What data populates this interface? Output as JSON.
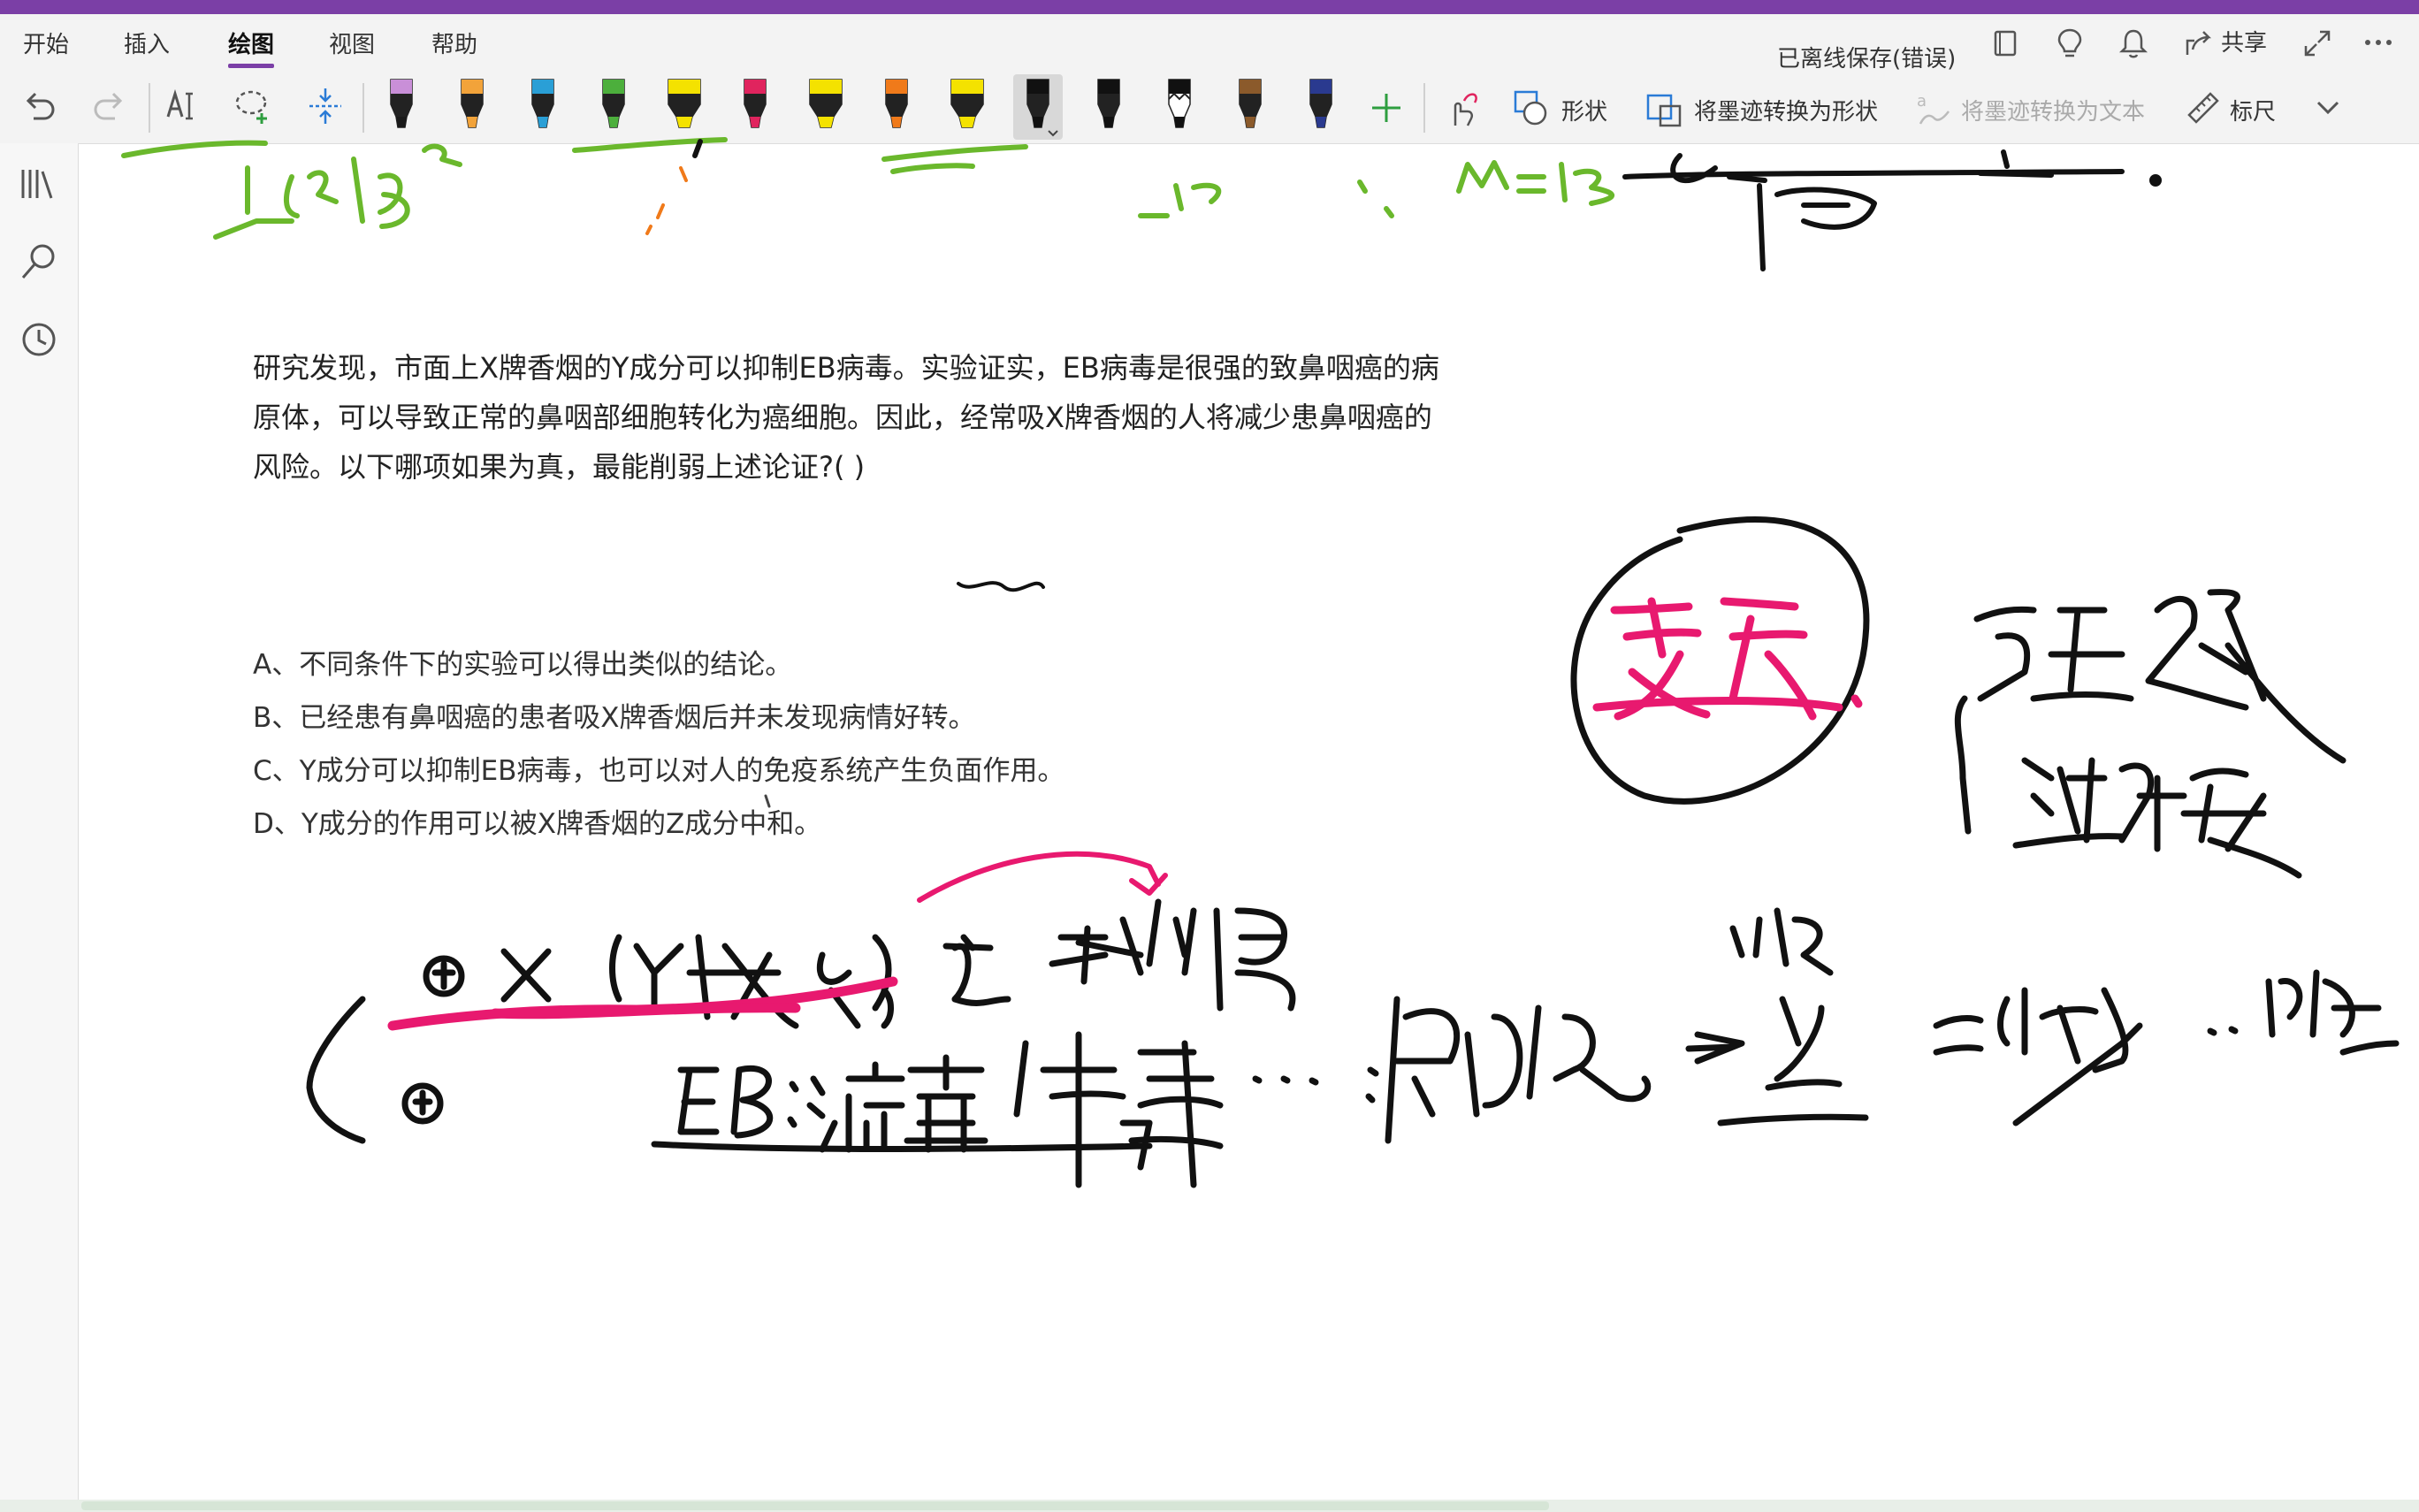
{
  "ribbon": {
    "tabs": [
      {
        "label": "开始",
        "active": false
      },
      {
        "label": "插入",
        "active": false
      },
      {
        "label": "绘图",
        "active": true
      },
      {
        "label": "视图",
        "active": false
      },
      {
        "label": "帮助",
        "active": false
      }
    ],
    "status": "已离线保存(错误)",
    "share_label": "共享"
  },
  "toolbar": {
    "shape_label": "形状",
    "ink_to_shape_label": "将墨迹转换为形状",
    "ink_to_text_label": "将墨迹转换为文本",
    "ruler_label": "标尺",
    "pens": [
      {
        "color": "#1a1a1a",
        "tip": "#c98fd8",
        "kind": "pen"
      },
      {
        "color": "#f2a33a",
        "kind": "pen"
      },
      {
        "color": "#2a9fd6",
        "kind": "pen"
      },
      {
        "color": "#4caf3c",
        "kind": "pen"
      },
      {
        "color": "#f4e200",
        "kind": "highlighter"
      },
      {
        "color": "#e0245e",
        "kind": "pen"
      },
      {
        "color": "#f4e200",
        "kind": "highlighter"
      },
      {
        "color": "#f07a1a",
        "kind": "pen"
      },
      {
        "color": "#f4e200",
        "kind": "highlighter"
      },
      {
        "color": "#111111",
        "kind": "pen",
        "selected": true
      },
      {
        "color": "#111111",
        "kind": "pen"
      },
      {
        "color": "#111111",
        "kind": "pattern"
      },
      {
        "color": "#8b5a2b",
        "kind": "galaxy"
      },
      {
        "color": "#2a3a8f",
        "kind": "galaxy"
      }
    ]
  },
  "question": {
    "stem_lines": [
      "研究发现，市面上X牌香烟的Y成分可以抑制EB病毒。实验证实，EB病毒是很强的致鼻咽癌的病",
      "原体，可以导致正常的鼻咽部细胞转化为癌细胞。因此，经常吸X牌香烟的人将减少患鼻咽癌的",
      "风险。以下哪项如果为真，最能削弱上述论证?( )"
    ],
    "options": [
      "A、不同条件下的实验可以得出类似的结论。",
      "B、已经患有鼻咽癌的患者吸X牌香烟后并未发现病情好转。",
      "C、Y成分可以抑制EB病毒，也可以对人的免疫系统产生负面作用。",
      "D、Y成分的作用可以被X牌香烟的Z成分中和。"
    ]
  },
  "colors": {
    "accent": "#7b3fa6",
    "ink_black": "#111111",
    "ink_pink": "#e8196f",
    "ink_green": "#6ab82c",
    "ink_orange": "#f07a1a"
  },
  "icons": {
    "undo": "undo-icon",
    "redo": "redo-icon",
    "lasso": "lasso-select-icon",
    "add_space": "insert-space-icon",
    "notebooks": "notebooks-icon",
    "search": "search-icon",
    "recent": "clock-icon"
  }
}
